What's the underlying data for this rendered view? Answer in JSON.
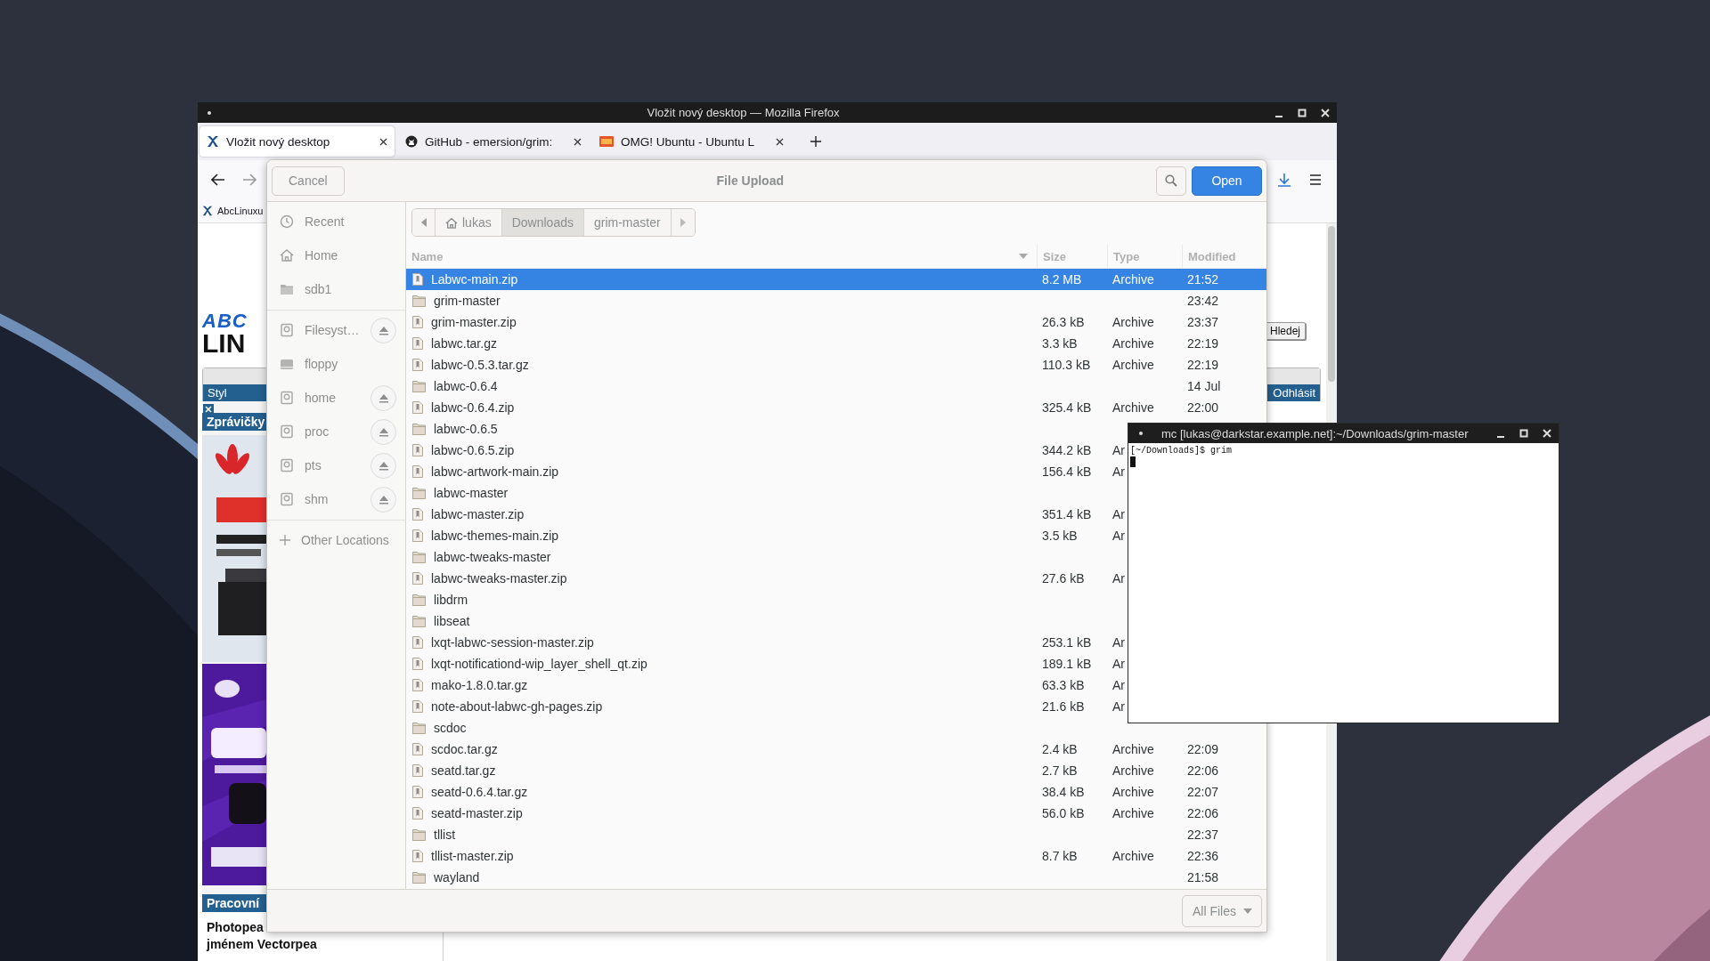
{
  "browser": {
    "title": "Vložit nový desktop — Mozilla Firefox",
    "tabs": [
      {
        "label": "Vložit nový desktop",
        "selected": true
      },
      {
        "label": "GitHub - emersion/grim:",
        "selected": false
      },
      {
        "label": "OMG! Ubuntu - Ubuntu L",
        "selected": false
      }
    ],
    "bookmarks": [
      {
        "label": "AbcLinuxu"
      }
    ],
    "page": {
      "logo_top": "ABC",
      "logo_bottom": "LIN",
      "search_button": "Hledej",
      "bar_left": "Styl",
      "bar_right": "Odhlásit",
      "news_heading": "Zprávičky",
      "section_heading": "Pracovní",
      "headline": "Photopea\njménem Vectorpea"
    }
  },
  "dialog": {
    "title": "File Upload",
    "cancel": "Cancel",
    "open": "Open",
    "places": [
      {
        "items": [
          {
            "label": "Recent",
            "kind": "recent"
          },
          {
            "label": "Home",
            "kind": "home"
          },
          {
            "label": "sdb1",
            "kind": "folder"
          }
        ]
      },
      {
        "items": [
          {
            "label": "Filesyst…",
            "kind": "volume",
            "eject": true
          },
          {
            "label": "floppy",
            "kind": "floppy",
            "eject": false
          },
          {
            "label": "home",
            "kind": "volume",
            "eject": true
          },
          {
            "label": "proc",
            "kind": "volume",
            "eject": true
          },
          {
            "label": "pts",
            "kind": "volume",
            "eject": true
          },
          {
            "label": "shm",
            "kind": "volume",
            "eject": true
          }
        ]
      },
      {
        "items": [
          {
            "label": "Other Locations",
            "kind": "other"
          }
        ]
      }
    ],
    "path": [
      {
        "label": "lukas",
        "kind": "home",
        "selected": false
      },
      {
        "label": "Downloads",
        "kind": "folder",
        "selected": true
      },
      {
        "label": "grim-master",
        "kind": "folder",
        "selected": false
      }
    ],
    "columns": [
      {
        "label": "Name",
        "sorted": true
      },
      {
        "label": "Size",
        "sorted": false
      },
      {
        "label": "Type",
        "sorted": false
      },
      {
        "label": "Modified",
        "sorted": false
      }
    ],
    "rows": [
      {
        "name": "Labwc-main.zip",
        "kind": "archive",
        "size": "8.2 MB",
        "type": "Archive",
        "modified": "21:52",
        "selected": true
      },
      {
        "name": "grim-master",
        "kind": "folder",
        "modified": "23:42",
        "selected": false
      },
      {
        "name": "grim-master.zip",
        "kind": "archive",
        "size": "26.3 kB",
        "type": "Archive",
        "modified": "23:37",
        "selected": false
      },
      {
        "name": "labwc.tar.gz",
        "kind": "archive",
        "size": "3.3 kB",
        "type": "Archive",
        "modified": "22:19",
        "selected": false
      },
      {
        "name": "labwc-0.5.3.tar.gz",
        "kind": "archive",
        "size": "110.3 kB",
        "type": "Archive",
        "modified": "22:19",
        "selected": false
      },
      {
        "name": "labwc-0.6.4",
        "kind": "folder",
        "modified": "14 Jul",
        "selected": false
      },
      {
        "name": "labwc-0.6.4.zip",
        "kind": "archive",
        "size": "325.4 kB",
        "type": "Archive",
        "modified": "22:00",
        "selected": false
      },
      {
        "name": "labwc-0.6.5",
        "kind": "folder",
        "selected": false
      },
      {
        "name": "labwc-0.6.5.zip",
        "kind": "archive",
        "size": "344.2 kB",
        "type": "Ar",
        "selected": false
      },
      {
        "name": "labwc-artwork-main.zip",
        "kind": "archive",
        "size": "156.4 kB",
        "type": "Ar",
        "selected": false
      },
      {
        "name": "labwc-master",
        "kind": "folder",
        "selected": false
      },
      {
        "name": "labwc-master.zip",
        "kind": "archive",
        "size": "351.4 kB",
        "type": "Ar",
        "selected": false
      },
      {
        "name": "labwc-themes-main.zip",
        "kind": "archive",
        "size": "3.5 kB",
        "type": "Ar",
        "selected": false
      },
      {
        "name": "labwc-tweaks-master",
        "kind": "folder",
        "selected": false
      },
      {
        "name": "labwc-tweaks-master.zip",
        "kind": "archive",
        "size": "27.6 kB",
        "type": "Ar",
        "selected": false
      },
      {
        "name": "libdrm",
        "kind": "folder",
        "selected": false
      },
      {
        "name": "libseat",
        "kind": "folder",
        "selected": false
      },
      {
        "name": "lxqt-labwc-session-master.zip",
        "kind": "archive",
        "size": "253.1 kB",
        "type": "Ar",
        "selected": false
      },
      {
        "name": "lxqt-notificationd-wip_layer_shell_qt.zip",
        "kind": "archive",
        "size": "189.1 kB",
        "type": "Ar",
        "selected": false
      },
      {
        "name": "mako-1.8.0.tar.gz",
        "kind": "archive",
        "size": "63.3 kB",
        "type": "Ar",
        "selected": false
      },
      {
        "name": "note-about-labwc-gh-pages.zip",
        "kind": "archive",
        "size": "21.6 kB",
        "type": "Ar",
        "selected": false
      },
      {
        "name": "scdoc",
        "kind": "folder",
        "selected": false
      },
      {
        "name": "scdoc.tar.gz",
        "kind": "archive",
        "size": "2.4 kB",
        "type": "Archive",
        "modified": "22:09",
        "selected": false
      },
      {
        "name": "seatd.tar.gz",
        "kind": "archive",
        "size": "2.7 kB",
        "type": "Archive",
        "modified": "22:06",
        "selected": false
      },
      {
        "name": "seatd-0.6.4.tar.gz",
        "kind": "archive",
        "size": "38.4 kB",
        "type": "Archive",
        "modified": "22:07",
        "selected": false
      },
      {
        "name": "seatd-master.zip",
        "kind": "archive",
        "size": "56.0 kB",
        "type": "Archive",
        "modified": "22:06",
        "selected": false
      },
      {
        "name": "tllist",
        "kind": "folder",
        "modified": "22:37",
        "selected": false
      },
      {
        "name": "tllist-master.zip",
        "kind": "archive",
        "size": "8.7 kB",
        "type": "Archive",
        "modified": "22:36",
        "selected": false
      },
      {
        "name": "wayland",
        "kind": "folder",
        "modified": "21:58",
        "selected": false
      }
    ],
    "filter": "All Files"
  },
  "terminal": {
    "title": "mc [lukas@darkstar.example.net]:~/Downloads/grim-master",
    "lines": [
      "[~/Downloads]$ grim"
    ]
  }
}
